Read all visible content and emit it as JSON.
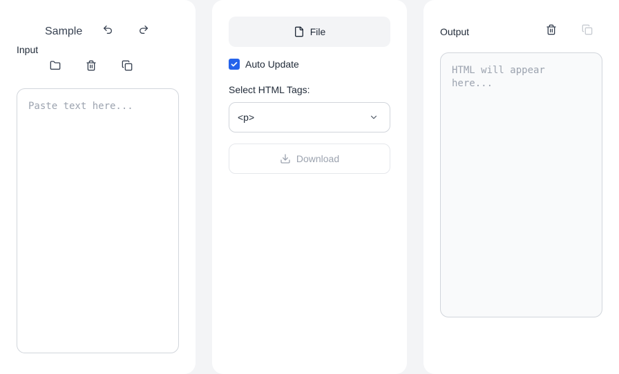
{
  "input_panel": {
    "sample_label": "Sample",
    "title": "Input",
    "placeholder": "Paste text here...",
    "icons": [
      "undo-icon",
      "redo-icon",
      "folder-icon",
      "trash-icon",
      "copy-icon"
    ]
  },
  "controls_panel": {
    "file_label": "File",
    "auto_update_label": "Auto Update",
    "auto_update_checked": true,
    "select_tags_label": "Select HTML Tags:",
    "selected_tag": "<p>",
    "download_label": "Download",
    "accent_color": "#2563eb"
  },
  "output_panel": {
    "title": "Output",
    "placeholder": "HTML will appear here...",
    "icons": [
      "trash-icon",
      "copy-icon"
    ]
  }
}
